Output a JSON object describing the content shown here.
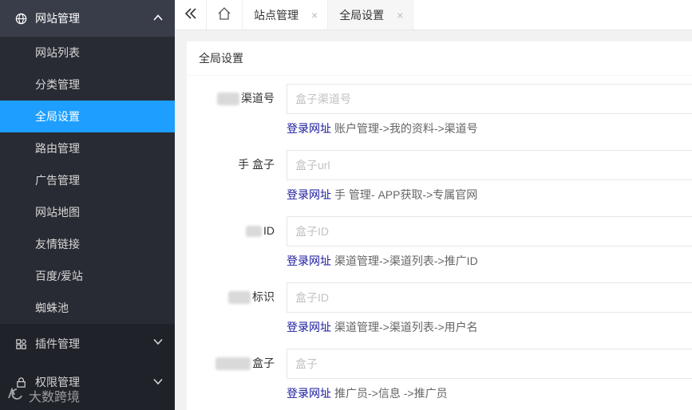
{
  "sidebar": {
    "parent_site": {
      "label": "网站管理",
      "icon": "globe-icon"
    },
    "items": [
      {
        "label": "网站列表"
      },
      {
        "label": "分类管理"
      },
      {
        "label": "全局设置"
      },
      {
        "label": "路由管理"
      },
      {
        "label": "广告管理"
      },
      {
        "label": "网站地图"
      },
      {
        "label": "友情链接"
      },
      {
        "label": "百度/爱站"
      },
      {
        "label": "蜘蛛池"
      }
    ],
    "active_index": 2,
    "parent_plugin": {
      "label": "插件管理",
      "icon": "apps-icon"
    },
    "parent_perm": {
      "label": "权限管理",
      "icon": "lock-icon"
    }
  },
  "watermark": {
    "text": "大数跨境"
  },
  "tabs": [
    {
      "label": "站点管理",
      "close": "×"
    },
    {
      "label": "全局设置",
      "close": "×"
    }
  ],
  "card": {
    "title": "全局设置"
  },
  "form": {
    "rows": [
      {
        "label": "渠道号",
        "placeholder": "盒子渠道号",
        "hint_link": "登录网址",
        "hint_text": "账户管理->我的资料->渠道号"
      },
      {
        "label": "手 盒子",
        "placeholder": "盒子url",
        "hint_link": "登录网址",
        "hint_text": "手 管理- APP获取->专属官网"
      },
      {
        "label": "ID",
        "placeholder": "盒子ID",
        "hint_link": "登录网址",
        "hint_text": "渠道管理->渠道列表->推广ID"
      },
      {
        "label": "标识",
        "placeholder": "盒子ID",
        "hint_link": "登录网址",
        "hint_text": "渠道管理->渠道列表->用户名"
      },
      {
        "label": "盒子",
        "placeholder": "盒子",
        "hint_link": "登录网址",
        "hint_text": "推广员->信息 ->推广员"
      }
    ]
  },
  "colors": {
    "sidebar_bg": "#20222a",
    "active": "#1e9fff",
    "link": "#1a1a9e"
  }
}
